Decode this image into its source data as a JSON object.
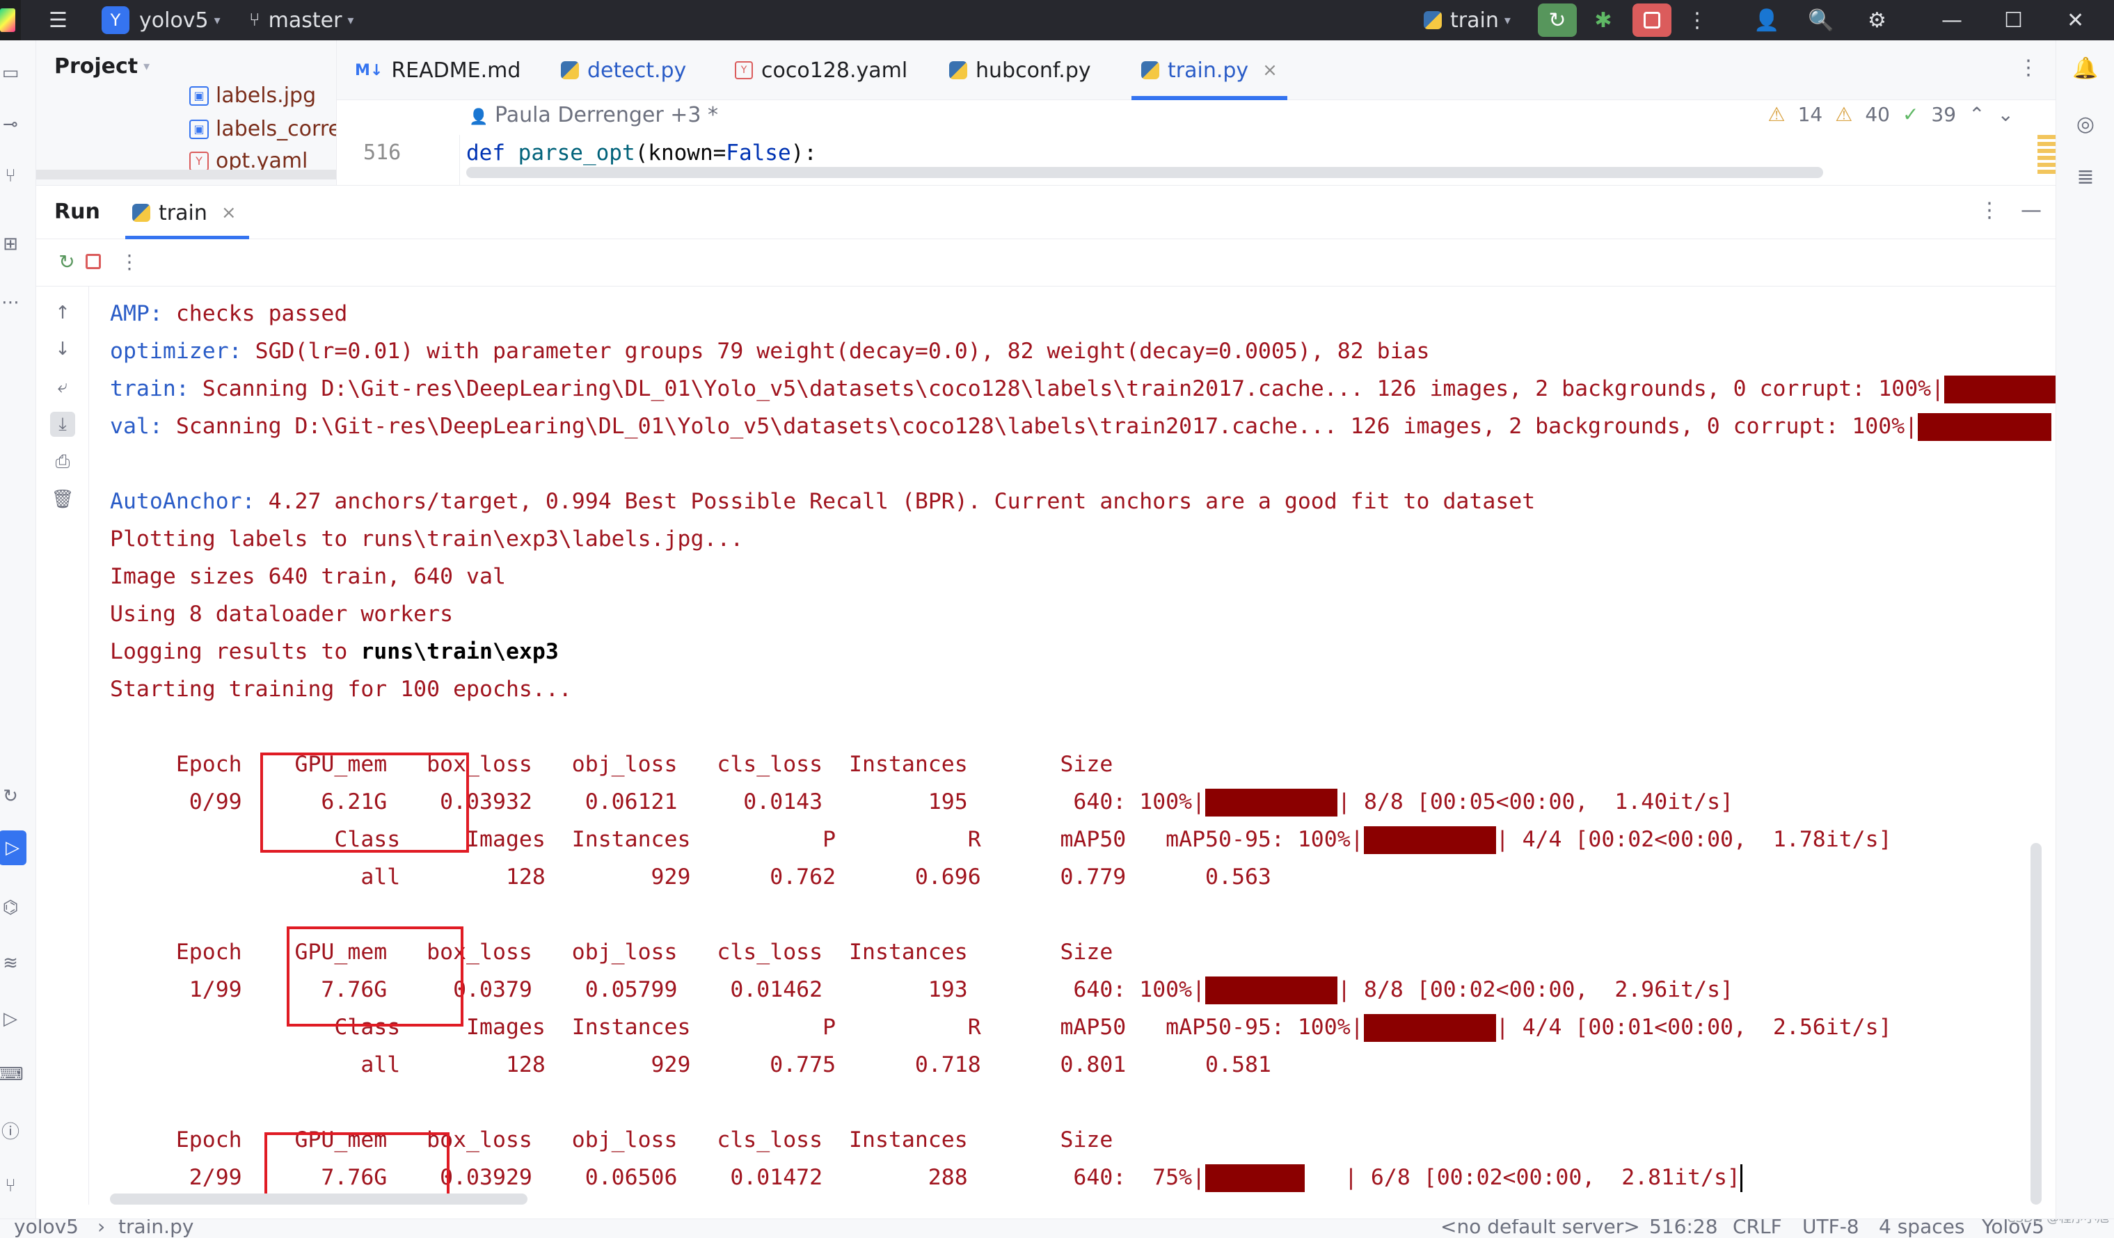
{
  "titlebar": {
    "project_badge": "Y",
    "project_name": "yolov5",
    "branch": "master",
    "run_config": "train"
  },
  "project_panel": {
    "title": "Project",
    "items": [
      {
        "label": "labels.jpg"
      },
      {
        "label": "labels_correlo"
      },
      {
        "label": "opt.yaml"
      }
    ]
  },
  "editor_tabs": [
    {
      "label": "README.md",
      "icon": "markdown-icon"
    },
    {
      "label": "detect.py",
      "icon": "python-file-icon"
    },
    {
      "label": "coco128.yaml",
      "icon": "yaml-file-icon"
    },
    {
      "label": "hubconf.py",
      "icon": "python-file-icon"
    },
    {
      "label": "train.py",
      "icon": "python-file-icon",
      "active": true
    }
  ],
  "editor": {
    "author": "Paula Derrenger +3 *",
    "line_number": "516",
    "code_def": "def ",
    "code_fn": "parse_opt",
    "code_open": "(known=",
    "code_false": "False",
    "code_close": "):",
    "warnings_a": "14",
    "warnings_b": "40",
    "typos": "39"
  },
  "run_panel": {
    "title": "Run",
    "tab_label": "train"
  },
  "console": {
    "lines": [
      {
        "prefix": "AMP:",
        "text": " checks passed"
      },
      {
        "prefix": "optimizer:",
        "text": " SGD(lr=0.01) with parameter groups 79 weight(decay=0.0), 82 weight(decay=0.0005), 82 bias"
      },
      {
        "prefix": "train:",
        "text": " Scanning D:\\Git-res\\DeepLearing\\DL_01\\Yolo_v5\\datasets\\coco128\\labels\\train2017.cache... 126 images, 2 backgrounds, 0 corrupt: 100%|"
      },
      {
        "prefix": "val:",
        "text": " Scanning D:\\Git-res\\DeepLearing\\DL_01\\Yolo_v5\\datasets\\coco128\\labels\\train2017.cache... 126 images, 2 backgrounds, 0 corrupt: 100%|"
      },
      {
        "prefix": "AutoAnchor:",
        "text": " 4.27 anchors/target, 0.994 Best Possible Recall (BPR). Current anchors are a good fit to dataset"
      },
      {
        "prefix": "",
        "text": "Plotting labels to runs\\train\\exp3\\labels.jpg..."
      },
      {
        "prefix": "",
        "text": "Image sizes 640 train, 640 val"
      },
      {
        "prefix": "",
        "text": "Using 8 dataloader workers"
      },
      {
        "prefix": "",
        "text": "Logging results to ",
        "bold": "runs\\train\\exp3"
      },
      {
        "prefix": "",
        "text": "Starting training for 100 epochs..."
      }
    ],
    "train_header": "     Epoch    GPU_mem   box_loss   obj_loss   cls_loss  Instances       Size",
    "val_header": "                 Class     Images  Instances          P          R      mAP50   mAP50-95: 100%|",
    "epochs": [
      {
        "train_row": "      0/99      6.21G    0.03932    0.06121     0.0143        195        640: 100%|",
        "train_tail": "| 8/8 [00:05<00:00,  1.40it/s]",
        "val_tail": "| 4/4 [00:02<00:00,  1.78it/s]",
        "all_row": "                   all        128        929      0.762      0.696      0.779      0.563",
        "progress": 1.0
      },
      {
        "train_row": "      1/99      7.76G     0.0379    0.05799    0.01462        193        640: 100%|",
        "train_tail": "| 8/8 [00:02<00:00,  2.96it/s]",
        "val_tail": "| 4/4 [00:01<00:00,  2.56it/s]",
        "all_row": "                   all        128        929      0.775      0.718      0.801      0.581",
        "progress": 1.0
      },
      {
        "train_row": "      2/99      7.76G    0.03929    0.06506    0.01472        288        640:  75%|",
        "train_tail": "   | 6/8 [00:02<00:00,  2.81it/s]",
        "progress": 0.75
      }
    ]
  },
  "statusbar": {
    "project": "yolov5",
    "file": "train.py",
    "server": "<no default server>",
    "position": "516:28",
    "line_sep": "CRLF",
    "encoding": "UTF-8",
    "indent": "4 spaces",
    "interpreter": "Yolov5"
  },
  "watermark": "CSDN @程序小旭",
  "colors": {
    "accent": "#3574f0",
    "console_text": "#a0141e",
    "progress_fill": "#8b0000",
    "highlight_box": "#e01b24"
  }
}
